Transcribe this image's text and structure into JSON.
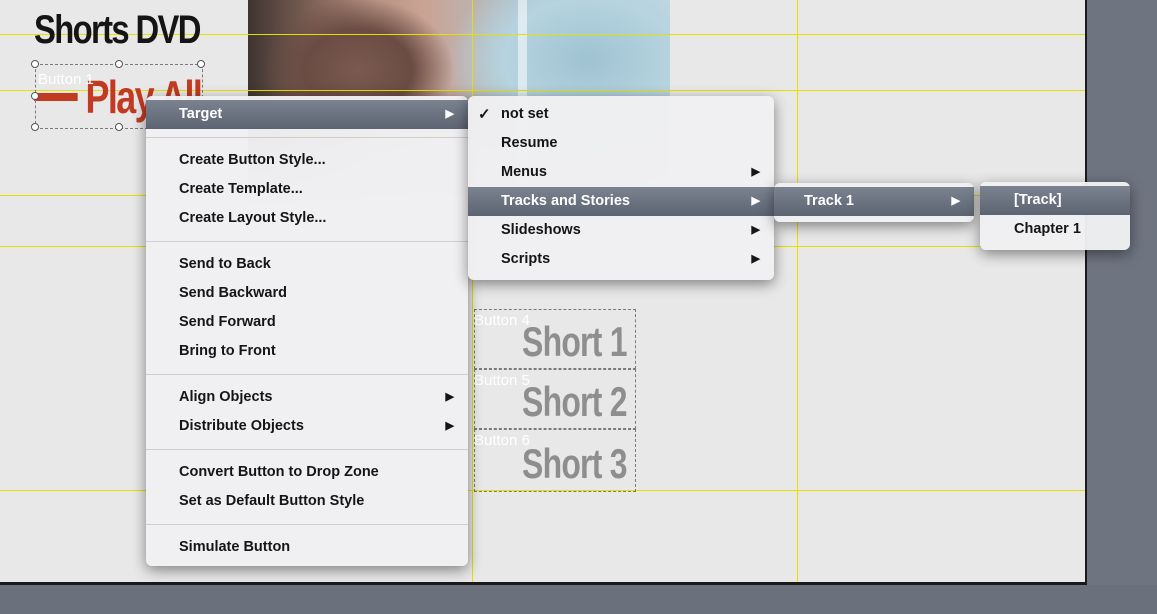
{
  "canvas": {
    "title": "Shorts DVD",
    "play_button_text": "Play All",
    "button_tag_play": "Button 1",
    "shorts": [
      {
        "tag": "Button 4",
        "text": "Short 1"
      },
      {
        "tag": "Button 5",
        "text": "Short 2"
      },
      {
        "tag": "Button 6",
        "text": "Short 3"
      }
    ]
  },
  "context_menu": {
    "items": [
      {
        "label": "Target",
        "submenu": true,
        "highlighted": true
      },
      {
        "separator": true
      },
      {
        "label": "Create Button Style..."
      },
      {
        "label": "Create Template..."
      },
      {
        "label": "Create Layout Style..."
      },
      {
        "separator": true
      },
      {
        "label": "Send to Back"
      },
      {
        "label": "Send Backward"
      },
      {
        "label": "Send Forward"
      },
      {
        "label": "Bring to Front"
      },
      {
        "separator": true
      },
      {
        "label": "Align Objects",
        "submenu": true
      },
      {
        "label": "Distribute Objects",
        "submenu": true
      },
      {
        "separator": true
      },
      {
        "label": "Convert Button to Drop Zone"
      },
      {
        "label": "Set as Default Button Style"
      },
      {
        "separator": true
      },
      {
        "label": "Simulate Button"
      }
    ]
  },
  "target_menu": {
    "items": [
      {
        "label": "not set",
        "checked": true
      },
      {
        "label": "Resume"
      },
      {
        "label": "Menus",
        "submenu": true
      },
      {
        "label": "Tracks and Stories",
        "submenu": true,
        "highlighted": true
      },
      {
        "label": "Slideshows",
        "submenu": true
      },
      {
        "label": "Scripts",
        "submenu": true
      }
    ]
  },
  "tracks_menu": {
    "items": [
      {
        "label": "Track 1",
        "submenu": true,
        "highlighted": true
      }
    ]
  },
  "track1_menu": {
    "items": [
      {
        "label": "[Track]",
        "highlighted": true
      },
      {
        "label": "Chapter 1"
      }
    ]
  },
  "colors": {
    "guide": "#e6e000",
    "highlight": "#5c6472",
    "play_text": "#c23a22"
  }
}
